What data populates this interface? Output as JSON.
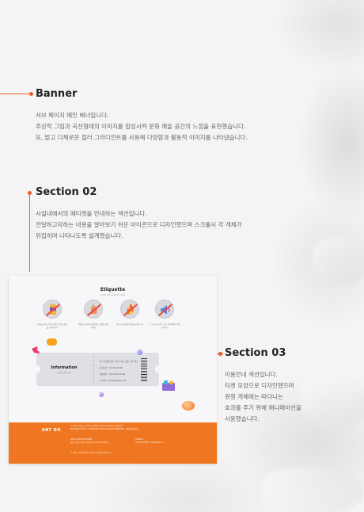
{
  "sections": {
    "banner": {
      "title": "Banner",
      "lines": [
        "서브 페이지 메인 배너입니다.",
        "추상적 그림과 곡선형태의 이미지를 합성시켜 문화 예술 공간의 느낌을 표현했습니다.",
        "또, 밝고 다채로운 컬러 그라디언트를 사용해 다양함과 활동적 이미지를 나타냈습니다."
      ]
    },
    "section02": {
      "title": "Section 02",
      "lines": [
        "시설내에서의 에티켓을 안내하는 섹션입니다.",
        "전달하고자하는 내용을 알아보기 쉬운 아이콘으로 디자인했으며 스크롤시 각 개체가",
        "뒤집히며 나타나도록 설계했습니다."
      ]
    },
    "section03": {
      "title": "Section 03",
      "lines": [
        "이용안내 섹션입니다.",
        "티켓 모양으로 디자인했으며",
        "원형 개체에는 떠다니는",
        "효과를 주기 위해 애니메이션을",
        "사용했습니다."
      ]
    }
  },
  "mockup": {
    "etiquette_title": "Etiquette",
    "etiquette_sub": "공연장 관람 에티켓 안내 Tips",
    "icons": [
      {
        "name": "no-drinks-icon",
        "caption": "음식물 반입 금지 및 관람 중 음료 섭취를 금지합니다"
      },
      {
        "name": "no-touch-icon",
        "caption": "작품을 만지거나 훼손하는 행위를 삼가 주세요"
      },
      {
        "name": "no-fire-icon",
        "caption": "화기 및 위험물 반입을 금지합니다"
      },
      {
        "name": "no-noise-icon",
        "caption": "큰 소리나 소음은 다른 관람객에게 방해가 됩니다"
      }
    ],
    "ticket": {
      "label": "Information",
      "label_sub": "공연장 이용 안내",
      "rows": [
        "월~일 정상운영, 기본 11층, 공휴, 휴무 참조",
        "운영시간 : 10:00~20:00",
        "대표번호 : 031-2345-6789",
        "E-mail : info@qwesay.com"
      ]
    },
    "footer": {
      "logo": "ART DO",
      "lines": [
        "본 사이트 포트폴리오 목적으로 제작된 사이트로 실제 기관과 무관합니다.",
        "DESIGN BY ART DO · COPYRIGHT 2023 ALL RIGHTS RESERVED · 개인정보처리방침",
        "ARTDO CULTURE CENTER",
        "경기도 성남시 분당구 미래로 12, Art Do Building",
        "CONTACT",
        "031-2345-6789 · info@artdo.com",
        "© 2023 · ARTDO Art Center. All rights reserved."
      ]
    }
  },
  "colors": {
    "accent": "#f15a24",
    "footer": "#f07722"
  }
}
